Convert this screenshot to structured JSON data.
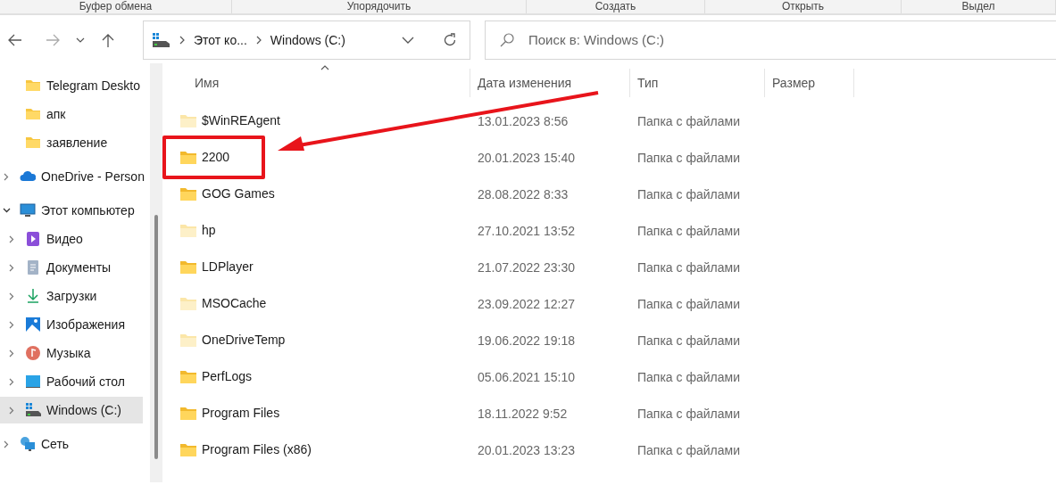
{
  "ribbon_groups": [
    "Буфер обмена",
    "Упорядочить",
    "Создать",
    "Открыть",
    "Выдел"
  ],
  "address_bar": {
    "segments": [
      "Этот ко...",
      "Windows (C:)"
    ]
  },
  "search": {
    "placeholder": "Поиск в: Windows (C:)"
  },
  "sidebar": {
    "items": [
      {
        "label": "Telegram Deskto",
        "kind": "folder",
        "selected": false
      },
      {
        "label": "апк",
        "kind": "folder",
        "selected": false
      },
      {
        "label": "заявление",
        "kind": "folder",
        "selected": false
      },
      {
        "label": "OneDrive - Person",
        "kind": "cloud",
        "selected": false,
        "expanded": false
      },
      {
        "label": "Этот компьютер",
        "kind": "pc",
        "selected": false,
        "expanded": true,
        "children": [
          {
            "label": "Видео",
            "kind": "video",
            "selected": false,
            "expanded": false
          },
          {
            "label": "Документы",
            "kind": "docs",
            "selected": false,
            "expanded": false
          },
          {
            "label": "Загрузки",
            "kind": "download",
            "selected": false,
            "expanded": false
          },
          {
            "label": "Изображения",
            "kind": "pictures",
            "selected": false,
            "expanded": false
          },
          {
            "label": "Музыка",
            "kind": "music",
            "selected": false,
            "expanded": false
          },
          {
            "label": "Рабочий стол",
            "kind": "desktop",
            "selected": false,
            "expanded": false
          },
          {
            "label": "Windows (C:)",
            "kind": "drive",
            "selected": true,
            "expanded": false
          }
        ]
      },
      {
        "label": "Сеть",
        "kind": "network",
        "selected": false,
        "expanded": false
      }
    ]
  },
  "table": {
    "columns": [
      "Имя",
      "Дата изменения",
      "Тип",
      "Размер"
    ],
    "rows": [
      {
        "name": "$WinREAgent",
        "date": "13.01.2023 8:56",
        "type": "Папка с файлами",
        "hidden": true,
        "highlighted": false
      },
      {
        "name": "2200",
        "date": "20.01.2023 15:40",
        "type": "Папка с файлами",
        "hidden": false,
        "highlighted": true
      },
      {
        "name": "GOG Games",
        "date": "28.08.2022 8:33",
        "type": "Папка с файлами",
        "hidden": false,
        "highlighted": false
      },
      {
        "name": "hp",
        "date": "27.10.2021 13:52",
        "type": "Папка с файлами",
        "hidden": true,
        "highlighted": false
      },
      {
        "name": "LDPlayer",
        "date": "21.07.2022 23:30",
        "type": "Папка с файлами",
        "hidden": false,
        "highlighted": false
      },
      {
        "name": "MSOCache",
        "date": "23.09.2022 12:27",
        "type": "Папка с файлами",
        "hidden": true,
        "highlighted": false
      },
      {
        "name": "OneDriveTemp",
        "date": "19.06.2022 19:18",
        "type": "Папка с файлами",
        "hidden": true,
        "highlighted": false
      },
      {
        "name": "PerfLogs",
        "date": "05.06.2021 15:10",
        "type": "Папка с файлами",
        "hidden": false,
        "highlighted": false
      },
      {
        "name": "Program Files",
        "date": "18.11.2022 9:52",
        "type": "Папка с файлами",
        "hidden": false,
        "highlighted": false
      },
      {
        "name": "Program Files (x86)",
        "date": "20.01.2023 13:23",
        "type": "Папка с файлами",
        "hidden": false,
        "highlighted": false
      }
    ]
  }
}
